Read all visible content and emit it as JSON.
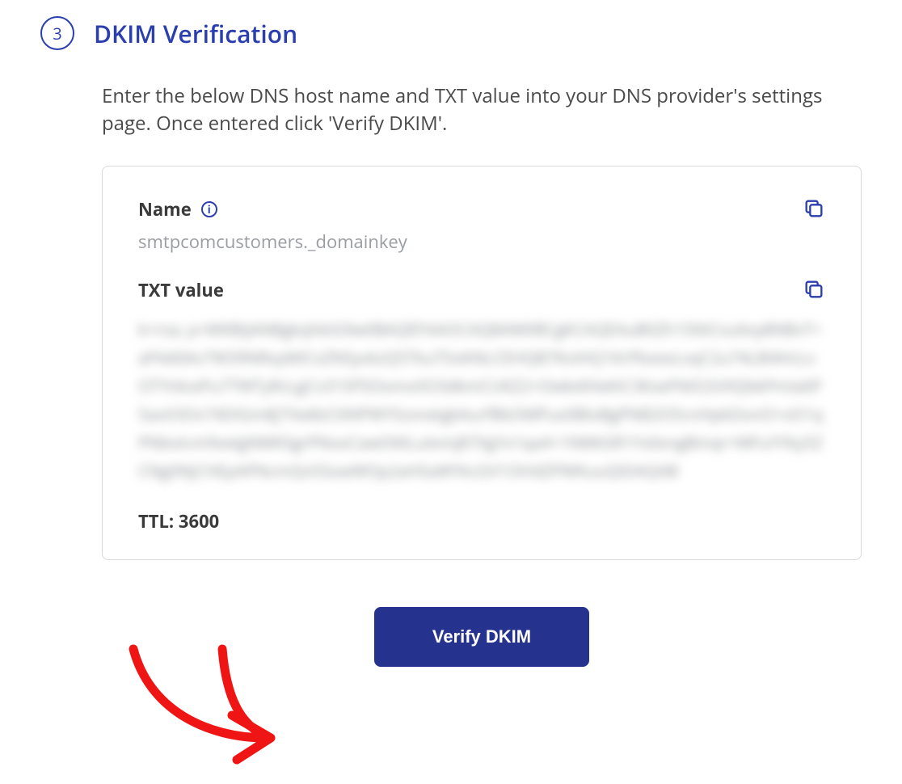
{
  "step": {
    "number": "3",
    "title": "DKIM Verification",
    "description": "Enter the below DNS host name and TXT value into your DNS provider's settings page. Once entered click 'Verify DKIM'."
  },
  "fields": {
    "name": {
      "label": "Name",
      "value": "smtpcomcustomers._domainkey"
    },
    "txt": {
      "label": "TXT value",
      "blurred_placeholder": "k=rsa; p=MIIBIjANBgkqhkiG9w0BAQEFAAOCAQ8AMIIBCgKCAQEAuB0Zh1SNICxu6vy8NBvT+aP4d0Av7W39NRxyMICxZNSyvkzQ5TkuT5oKNLCEHQB7KviHQ1KrPbxexLvqC2u74L8l4HcLvOTYt4cePu7TWTyRcLgCv315PSOomxXO3dkmCUKZ2+OwbdVIeKiC3KseFNIO2VXQbkPmIa6P5axX3Ov74DIGm8j7Vw8zC6NPWY5zvnetgkAurf8bOMPux0BloBgPNB2O5cnHpkDonO+vO1qPNboIcm9xeIgNMKSgrPNoxCawOtKLulomj87XgYx1qa4+1NMtGR1Ys0xngBmqr+MFuYYky5ZCNg0NjCHEpAPNcmQv5SowWOp2aHSaWYkcGV1OHdZPWKuuQIDAQAB"
    }
  },
  "ttl": {
    "label": "TTL",
    "value": "3600"
  },
  "button": {
    "verify_label": "Verify DKIM"
  }
}
